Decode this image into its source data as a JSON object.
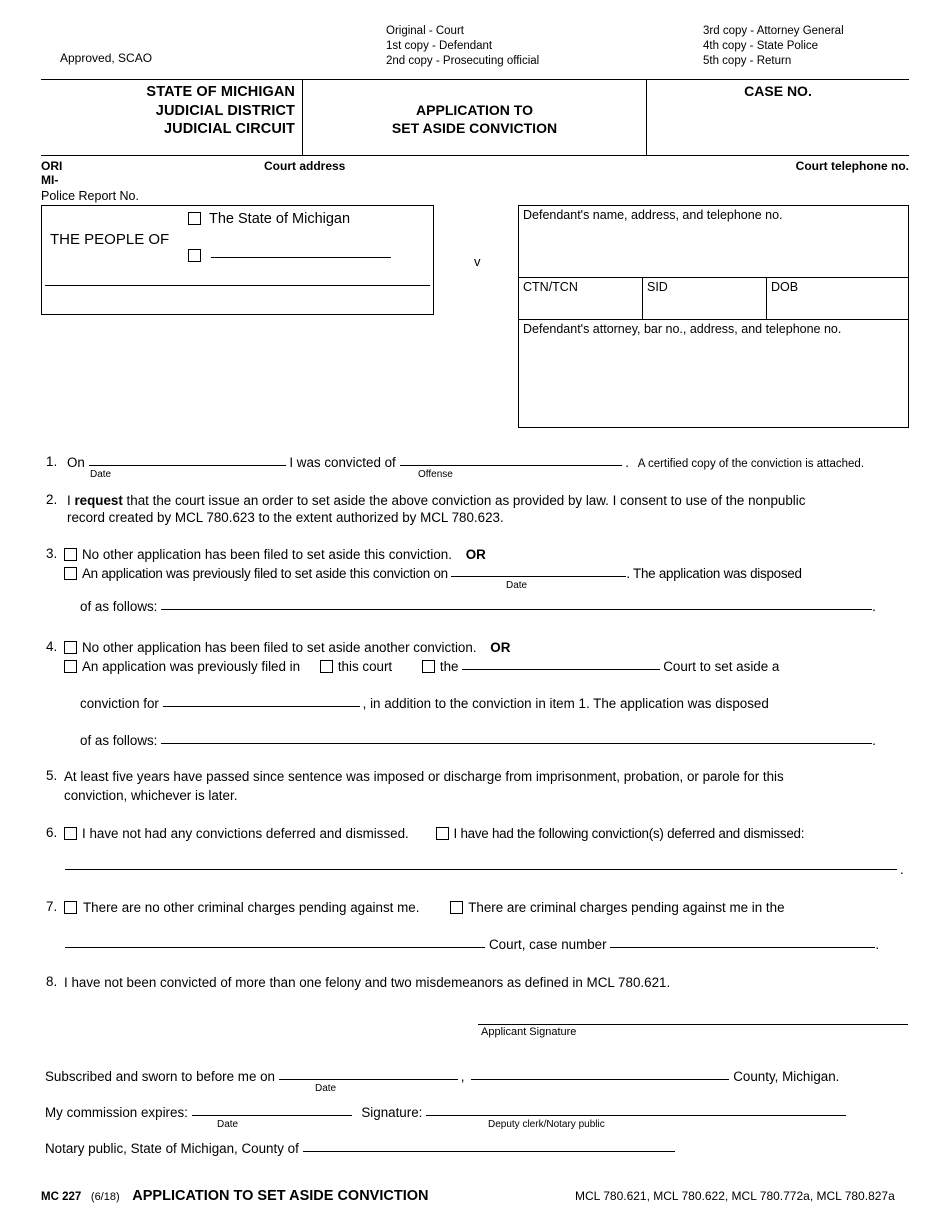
{
  "distribution": {
    "left": [
      "Original - Court",
      "1st copy - Defendant",
      "2nd copy - Prosecuting official"
    ],
    "right": [
      "3rd copy - Attorney General",
      "4th copy - State Police",
      "5th copy - Return"
    ]
  },
  "approved": "Approved, SCAO",
  "header": {
    "state_line1": "STATE OF MICHIGAN",
    "state_line2": "JUDICIAL DISTRICT",
    "state_line3": "JUDICIAL CIRCUIT",
    "title_line1": "APPLICATION TO",
    "title_line2": "SET ASIDE CONVICTION",
    "case_no_label": "CASE NO."
  },
  "ori_row": {
    "ori_label": "ORI",
    "ori_prefix": "MI-",
    "police_report_label": "Police Report No.",
    "court_address_label": "Court address",
    "court_telephone_label": "Court telephone no."
  },
  "parties": {
    "people_of": "THE PEOPLE OF",
    "state_of_michigan": "The State of Michigan",
    "versus": "v"
  },
  "defendant": {
    "name_label": "Defendant's name, address, and telephone no.",
    "ctn_label": "CTN/TCN",
    "sid_label": "SID",
    "dob_label": "DOB",
    "attorney_label": "Defendant's attorney, bar no., address, and telephone no."
  },
  "items": {
    "i1": {
      "num": "1.",
      "on": "On",
      "date_label": "Date",
      "convicted_of": "I was convicted of",
      "offense_label": "Offense",
      "period": ".",
      "certified": "A certified copy of the conviction is attached."
    },
    "i2": {
      "num": "2.",
      "lead": "I ",
      "request": "request",
      "text_a": " that the court issue an order to set aside the above conviction as provided by law. I consent to use of the nonpublic",
      "text_b": "record created by MCL 780.623 to the extent authorized by MCL 780.623."
    },
    "i3": {
      "num": "3.",
      "option_a": "No other application has been filed to set aside this conviction.",
      "or": "OR",
      "option_b": "An application was previously filed to set aside this conviction on",
      "date_label": "Date",
      "tail": ". The application was disposed",
      "of_as_follows": "of as follows:",
      "period": "."
    },
    "i4": {
      "num": "4.",
      "option_a": "No other application has been filed to set aside another conviction.",
      "or": "OR",
      "option_b": "An application was previously filed in",
      "this_court": "this court",
      "the": "the",
      "court_to_set_aside": "Court to set aside a",
      "conviction_for": "conviction for",
      "in_addition": ", in addition to the conviction in item 1. The application was disposed",
      "of_as_follows": "of as follows:",
      "period": "."
    },
    "i5": {
      "num": "5.",
      "text_a": "At least five years have passed since sentence was imposed or discharge from imprisonment, probation, or parole for this",
      "text_b": "conviction, whichever is later."
    },
    "i6": {
      "num": "6.",
      "option_a": "I have not had any convictions deferred and dismissed.",
      "option_b": "I have had the following conviction(s) deferred and dismissed:",
      "period": "."
    },
    "i7": {
      "num": "7.",
      "option_a": "There are no other criminal charges pending against me.",
      "option_b": "There are criminal charges pending against me in the",
      "court_case_number": "Court, case number",
      "period": "."
    },
    "i8": {
      "num": "8.",
      "text": "I have not been convicted of more than one felony and two misdemeanors as defined in MCL 780.621."
    }
  },
  "signature": {
    "applicant_signature_label": "Applicant Signature",
    "subscribed": "Subscribed and sworn to before me on",
    "date_label_1": "Date",
    "comma": ",",
    "county_michigan": "County, Michigan.",
    "commission_expires": "My commission expires:",
    "date_label_2": "Date",
    "signature_label": "Signature:",
    "deputy_clerk": "Deputy clerk/Notary public",
    "notary_public_county": "Notary public, State of Michigan, County of"
  },
  "footer": {
    "form_no": "MC 227",
    "revision": "(6/18)",
    "title": "APPLICATION TO SET ASIDE CONVICTION",
    "citations": "MCL 780.621, MCL 780.622, MCL 780.772a, MCL 780.827a"
  }
}
